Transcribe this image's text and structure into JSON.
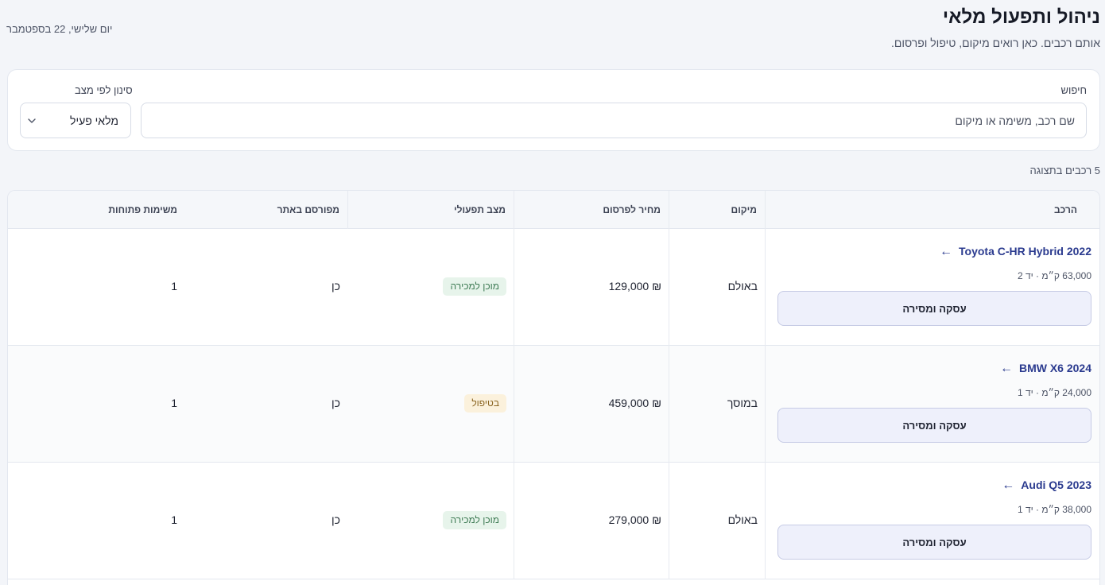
{
  "header": {
    "title": "ניהול ותפעול מלאי",
    "subtitle": "אותם רכבים. כאן רואים מיקום, טיפול ופרסום.",
    "date": "יום שלישי, 22 בספטמבר"
  },
  "filters": {
    "search_label": "חיפוש",
    "search_placeholder": "שם רכב, משימה או מיקום",
    "status_label": "סינון לפי מצב",
    "status_value": "מלאי פעיל"
  },
  "results": {
    "count_text": "5 רכבים בתצוגה"
  },
  "table": {
    "headers": {
      "vehicle": "הרכב",
      "location": "מיקום",
      "price": "מחיר לפרסום",
      "status": "מצב תפעולי",
      "published": "מפורסם באתר",
      "open_tasks": "משימות פתוחות"
    },
    "rows": [
      {
        "name": "Toyota C-HR Hybrid 2022",
        "arrow": "←",
        "meta": "63,000 ק״מ · יד 2",
        "action": "עסקה ומסירה",
        "location": "באולם",
        "price": "₪ 129,000",
        "status": "מוכן למכירה",
        "published": "כן",
        "open_tasks": "1"
      },
      {
        "name": "BMW X6 2024",
        "arrow": "←",
        "meta": "24,000 ק״מ · יד 1",
        "action": "עסקה ומסירה",
        "location": "במוסך",
        "price": "₪ 459,000",
        "status": "בטיפול",
        "published": "כן",
        "open_tasks": "1"
      },
      {
        "name": "Audi Q5 2023",
        "arrow": "←",
        "meta": "38,000 ק״מ · יד 1",
        "action": "עסקה ומסירה",
        "location": "באולם",
        "price": "₪ 279,000",
        "status": "מוכן למכירה",
        "published": "כן",
        "open_tasks": "1"
      }
    ]
  },
  "colors": {
    "accent": "#2b3b8f",
    "ready_bg": "#e7f4eb",
    "ready_text": "#3d7a53",
    "service_bg": "#fbf1dc",
    "service_text": "#8a6420"
  },
  "icons": {
    "select_chevron": "chevron-down-icon",
    "vehicle_link": "arrow-left-icon"
  }
}
